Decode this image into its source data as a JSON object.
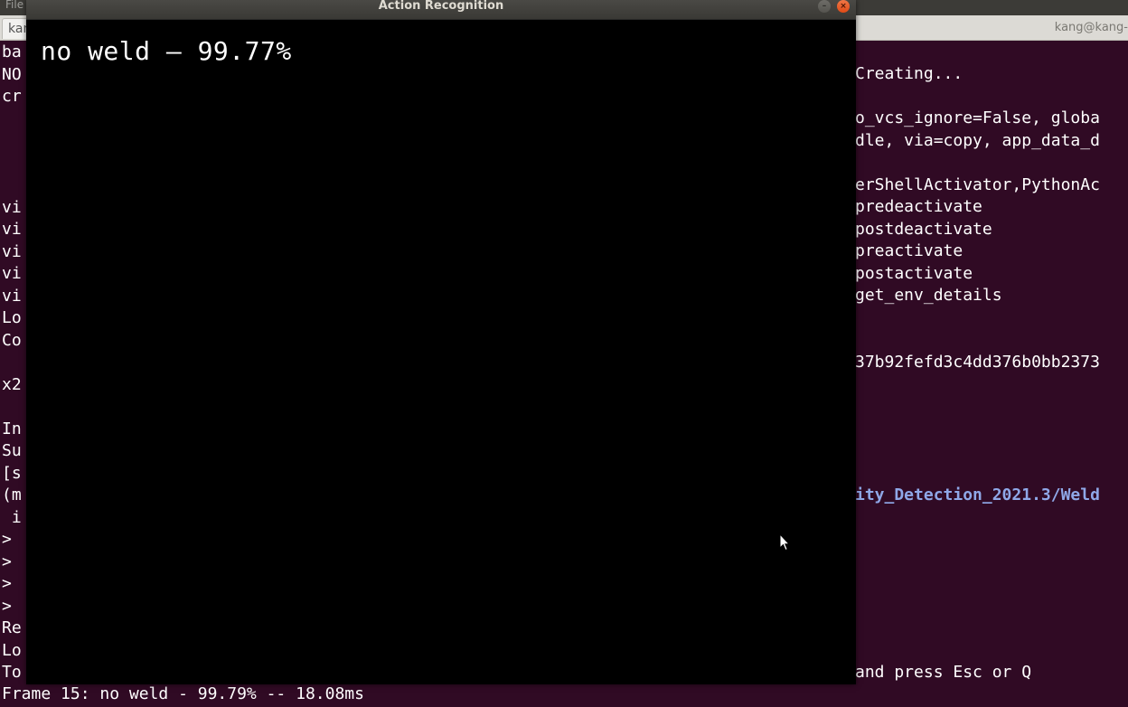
{
  "menubar": {
    "file_label": "File"
  },
  "tabs": {
    "left_tab_label": "kang@kang",
    "right_tab_label": "kang@kang-"
  },
  "terminal": {
    "left_lines": [
      "ba",
      "NO",
      "cr",
      "  ",
      "  ",
      "",
      "  ",
      "vi",
      "vi",
      "vi",
      "vi",
      "vi",
      "Lo",
      "Co",
      "  ",
      "x2",
      "",
      "In",
      "Su",
      "[s",
      "(m",
      " i",
      ">",
      ">",
      ">",
      ">",
      "Re",
      "Lo",
      "To"
    ],
    "right_lines": [
      "Creating...",
      "",
      "o_vcs_ignore=False, globa",
      "dle, via=copy, app_data_d",
      "",
      "erShellActivator,PythonAc",
      "predeactivate",
      "postdeactivate",
      "preactivate",
      "postactivate",
      "get_env_details",
      "",
      "",
      "37b92fefd3c4dd376b0bb2373",
      "",
      "",
      "",
      "",
      "",
      "ity_Detection_2021.3/Weld",
      "",
      "",
      "",
      "",
      "",
      "",
      "",
      "and press Esc or Q"
    ],
    "link_line_index": 19,
    "bottom_line": "Frame 15: no weld - 99.79% -- 18.08ms"
  },
  "cv_window": {
    "title": "Action Recognition",
    "overlay_text": "no weld — 99.77%"
  },
  "colors": {
    "terminal_bg": "#300a24",
    "terminal_fg": "#ffffff",
    "link": "#8fa8e8",
    "close_button": "#df4a16"
  },
  "icons": {
    "cursor": "mouse-pointer-icon",
    "close": "close-icon",
    "minimize": "minimize-icon"
  }
}
